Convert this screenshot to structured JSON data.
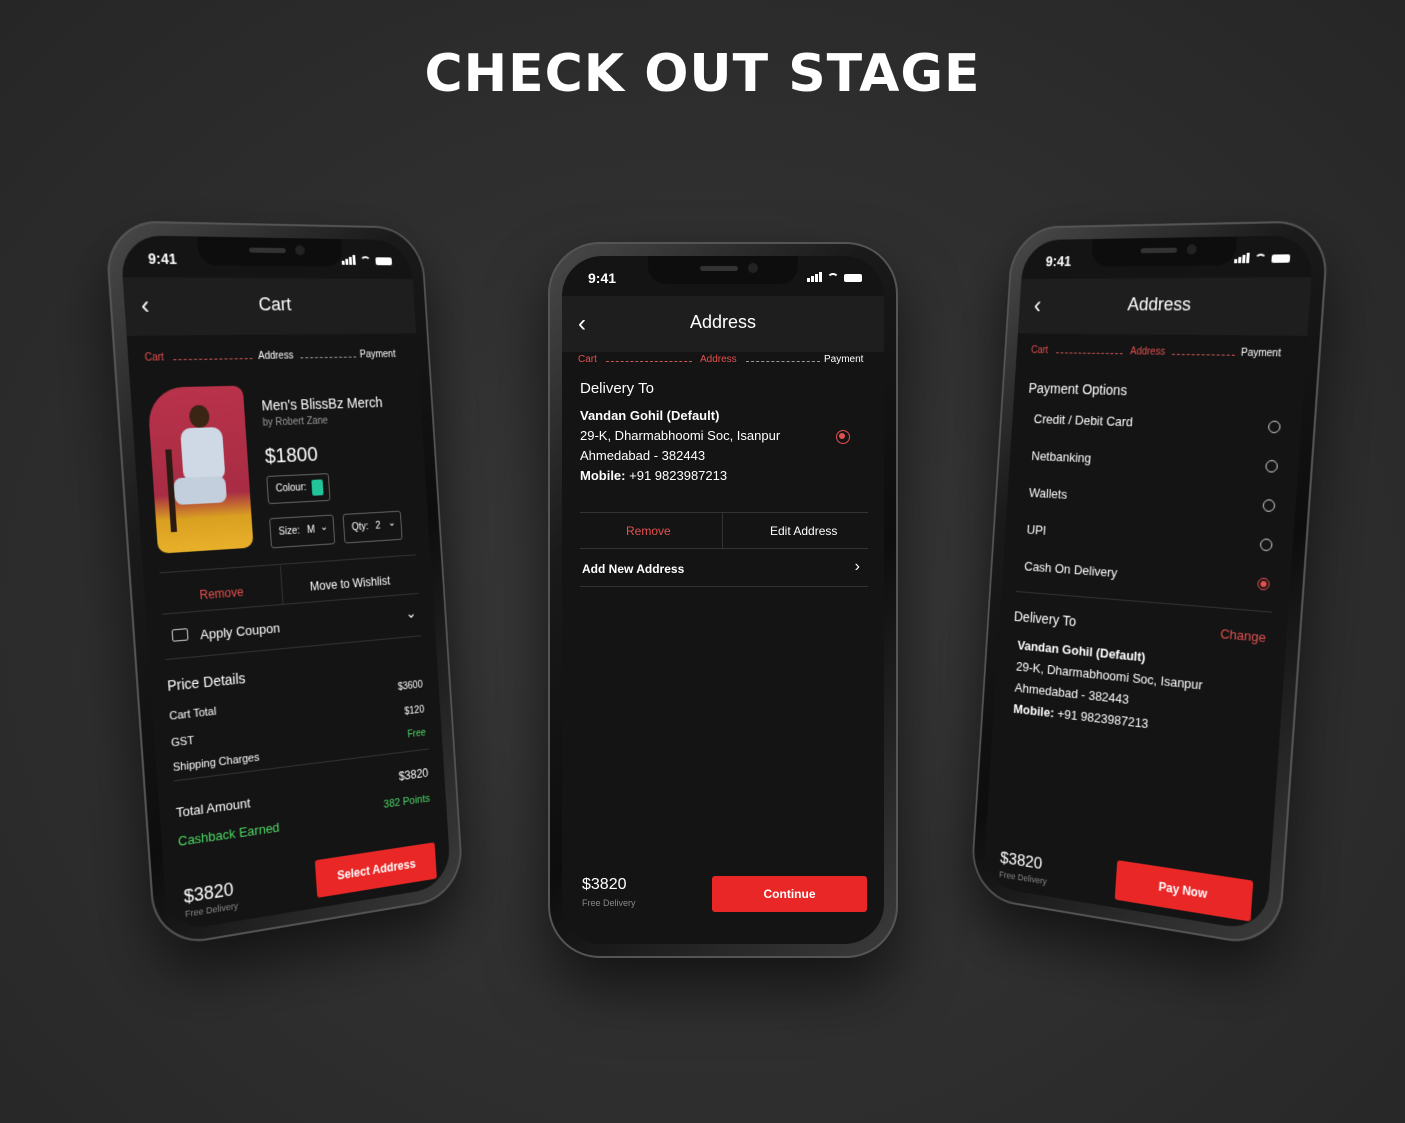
{
  "headline": "CHECK OUT STAGE",
  "status_time": "9:41",
  "steps": {
    "cart": "Cart",
    "address": "Address",
    "payment": "Payment"
  },
  "cart_screen": {
    "title": "Cart",
    "product": {
      "name": "Men's BlissBz Merch",
      "by": "by Robert Zane",
      "price": "$1800",
      "colour_label": "Colour:",
      "colour": "#22c59a",
      "size_label": "Size:",
      "size": "M",
      "qty_label": "Qty:",
      "qty": "2"
    },
    "remove": "Remove",
    "move_wishlist": "Move to Wishlist",
    "apply_coupon": "Apply Coupon",
    "price_details": "Price Details",
    "rows": [
      {
        "label": "Cart Total",
        "value": "$3600"
      },
      {
        "label": "GST",
        "value": "$120"
      },
      {
        "label": "Shipping Charges",
        "value": "Free"
      }
    ],
    "total_label": "Total Amount",
    "total_value": "$3820",
    "cashback_label": "Cashback Earned",
    "cashback_value": "382 Points",
    "footer_price": "$3820",
    "footer_sub": "Free Delivery",
    "cta": "Select Address"
  },
  "address_screen": {
    "title": "Address",
    "delivery_to": "Delivery To",
    "name": "Vandan Gohil (Default)",
    "line1": "29-K, Dharmabhoomi Soc, Isanpur",
    "line2": "Ahmedabad - 382443",
    "mobile_label": "Mobile:",
    "mobile": "+91 9823987213",
    "remove": "Remove",
    "edit": "Edit Address",
    "add_new": "Add New Address",
    "footer_price": "$3820",
    "footer_sub": "Free Delivery",
    "cta": "Continue"
  },
  "payment_screen": {
    "title": "Address",
    "options_title": "Payment Options",
    "options": [
      {
        "label": "Credit / Debit Card",
        "selected": false
      },
      {
        "label": "Netbanking",
        "selected": false
      },
      {
        "label": "Wallets",
        "selected": false
      },
      {
        "label": "UPI",
        "selected": false
      },
      {
        "label": "Cash On Delivery",
        "selected": true
      }
    ],
    "delivery_to": "Delivery To",
    "change": "Change",
    "name": "Vandan Gohil (Default)",
    "line1": "29-K, Dharmabhoomi Soc, Isanpur",
    "line2": "Ahmedabad - 382443",
    "mobile_label": "Mobile:",
    "mobile": "+91 9823987213",
    "footer_price": "$3820",
    "footer_sub": "Free Delivery",
    "cta": "Pay Now"
  },
  "colors": {
    "accent": "#e92727",
    "green": "#4cd964",
    "background": "#2e2e2e"
  }
}
